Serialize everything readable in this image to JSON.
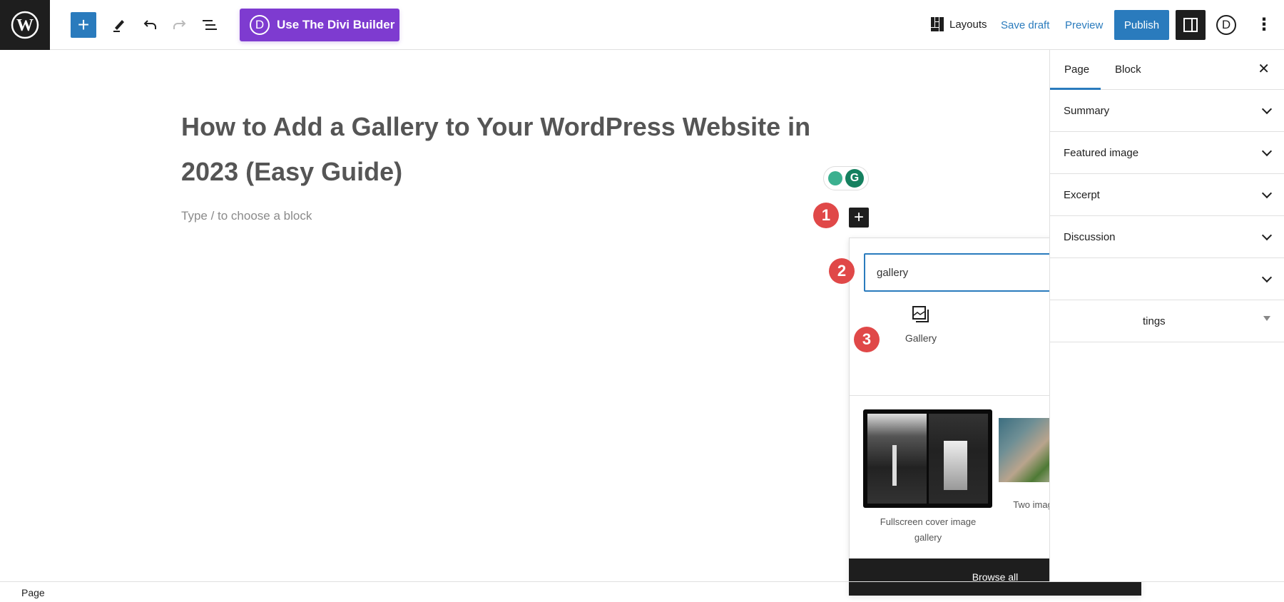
{
  "toolbar": {
    "logo": "wordpress-logo",
    "divi_label": "Use The Divi Builder",
    "divi_letter": "D",
    "layouts_label": "Layouts",
    "save_draft_label": "Save draft",
    "preview_label": "Preview",
    "publish_label": "Publish",
    "more_label": "⋮"
  },
  "editor": {
    "title": "How to Add a Gallery to Your WordPress Website in 2023 (Easy Guide)",
    "placeholder": "Type / to choose a block"
  },
  "annotations": [
    "1",
    "2",
    "3"
  ],
  "inserter": {
    "search_value": "gallery",
    "result_label": "Gallery",
    "patterns": [
      {
        "label": "Fullscreen cover image gallery"
      },
      {
        "label": "Two images side by side"
      }
    ],
    "browse_all_label": "Browse all"
  },
  "sidebar": {
    "tabs": [
      {
        "label": "Page",
        "active": true
      },
      {
        "label": "Block",
        "active": false
      }
    ],
    "panels": [
      {
        "label": "Summary"
      },
      {
        "label": "Featured image"
      },
      {
        "label": "Excerpt"
      },
      {
        "label": "Discussion"
      },
      {
        "label": ""
      },
      {
        "label": "tings"
      }
    ]
  },
  "footer": {
    "breadcrumb": "Page"
  },
  "colors": {
    "accent": "#2a7bbd",
    "divi": "#7e3bd0",
    "badge": "#e04848",
    "dark": "#1e1e1e"
  }
}
